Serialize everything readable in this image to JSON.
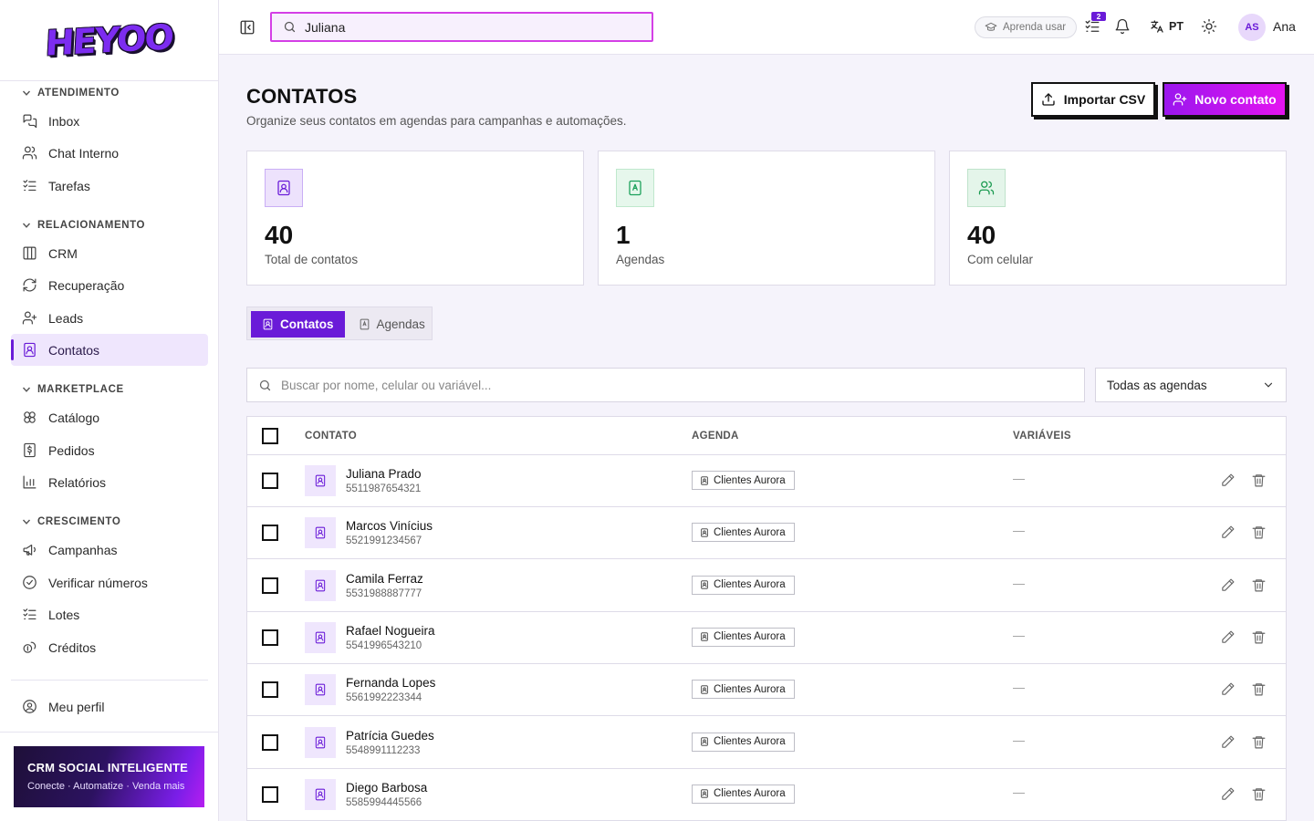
{
  "app": {
    "logo_text": "HEYOO"
  },
  "sidebar": {
    "sections": [
      {
        "title": "ATENDIMENTO",
        "items": [
          "Inbox",
          "Chat Interno",
          "Tarefas"
        ]
      },
      {
        "title": "RELACIONAMENTO",
        "items": [
          "CRM",
          "Recuperação",
          "Leads",
          "Contatos"
        ]
      },
      {
        "title": "MARKETPLACE",
        "items": [
          "Catálogo",
          "Pedidos",
          "Relatórios"
        ]
      },
      {
        "title": "CRESCIMENTO",
        "items": [
          "Campanhas",
          "Verificar números",
          "Lotes",
          "Créditos"
        ]
      }
    ],
    "active_item": "Contatos",
    "profile_label": "Meu perfil",
    "promo": {
      "title": "CRM SOCIAL INTELIGENTE",
      "subtitle": "Conecte · Automatize · Venda mais"
    }
  },
  "topbar": {
    "search_value": "Juliana",
    "learn_label": "Aprenda usar",
    "tasks_badge": "2",
    "language": "PT",
    "avatar_initials": "AS",
    "user_name": "Ana"
  },
  "page": {
    "title": "CONTATOS",
    "subtitle": "Organize seus contatos em agendas para campanhas e automações.",
    "import_label": "Importar CSV",
    "new_label": "Novo contato"
  },
  "stats": [
    {
      "value": "40",
      "label": "Total de contatos",
      "icon": "contact-book-icon",
      "color": "#6a1bd8"
    },
    {
      "value": "1",
      "label": "Agendas",
      "icon": "agenda-icon",
      "color": "#1aa05a"
    },
    {
      "value": "40",
      "label": "Com celular",
      "icon": "users-icon",
      "color": "#1a9a50"
    }
  ],
  "tabs": {
    "contacts": "Contatos",
    "agendas": "Agendas",
    "active": "Contatos"
  },
  "filters": {
    "search_placeholder": "Buscar por nome, celular ou variável...",
    "agenda_select": "Todas as agendas"
  },
  "table": {
    "headers": {
      "contact": "CONTATO",
      "agenda": "AGENDA",
      "variables": "VARIÁVEIS"
    },
    "rows": [
      {
        "name": "Juliana Prado",
        "phone": "5511987654321",
        "agenda": "Clientes Aurora",
        "variables": "—"
      },
      {
        "name": "Marcos Vinícius",
        "phone": "5521991234567",
        "agenda": "Clientes Aurora",
        "variables": "—"
      },
      {
        "name": "Camila Ferraz",
        "phone": "5531988887777",
        "agenda": "Clientes Aurora",
        "variables": "—"
      },
      {
        "name": "Rafael Nogueira",
        "phone": "5541996543210",
        "agenda": "Clientes Aurora",
        "variables": "—"
      },
      {
        "name": "Fernanda Lopes",
        "phone": "5561992223344",
        "agenda": "Clientes Aurora",
        "variables": "—"
      },
      {
        "name": "Patrícia Guedes",
        "phone": "5548991112233",
        "agenda": "Clientes Aurora",
        "variables": "—"
      },
      {
        "name": "Diego Barbosa",
        "phone": "5585994445566",
        "agenda": "Clientes Aurora",
        "variables": "—"
      }
    ]
  },
  "colors": {
    "accent": "#6a1bd8",
    "accent_light": "#efe6fd",
    "brand_gradient_end": "#e414f0"
  }
}
